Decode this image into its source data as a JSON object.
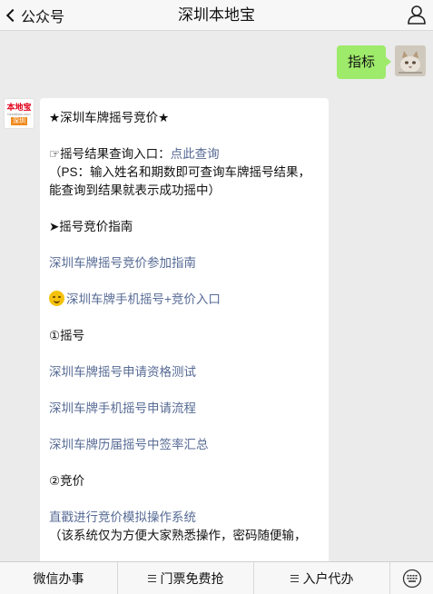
{
  "header": {
    "back_label": "公众号",
    "title": "深圳本地宝"
  },
  "outgoing_message": {
    "text": "指标"
  },
  "account_avatar": {
    "line1": "本地宝",
    "line2": "bendibao.com",
    "line3": "深圳"
  },
  "incoming_message": {
    "heading": "★深圳车牌摇号竞价★",
    "query_prefix": "☞摇号结果查询入口：",
    "query_link": "点此查询",
    "ps_line1": "（PS：输入姓名和期数即可查询车牌摇号结果，",
    "ps_line2": "能查询到结果就表示成功摇中）",
    "guide_heading": "➤摇号竞价指南",
    "guide_link": "深圳车牌摇号竞价参加指南",
    "mobile_link": "深圳车牌手机摇号+竞价入口",
    "section1": "①摇号",
    "link_qualification": "深圳车牌摇号申请资格测试",
    "link_process": "深圳车牌手机摇号申请流程",
    "link_rates": "深圳车牌历届摇号中签率汇总",
    "section2": "②竞价",
    "link_simulation": "直戳进行竞价模拟操作系统",
    "note": "（该系统仅为方便大家熟悉操作，密码随便输，"
  },
  "bottom_menu": {
    "item1": "微信办事",
    "item2": "门票免费抢",
    "item3": "入户代办"
  }
}
